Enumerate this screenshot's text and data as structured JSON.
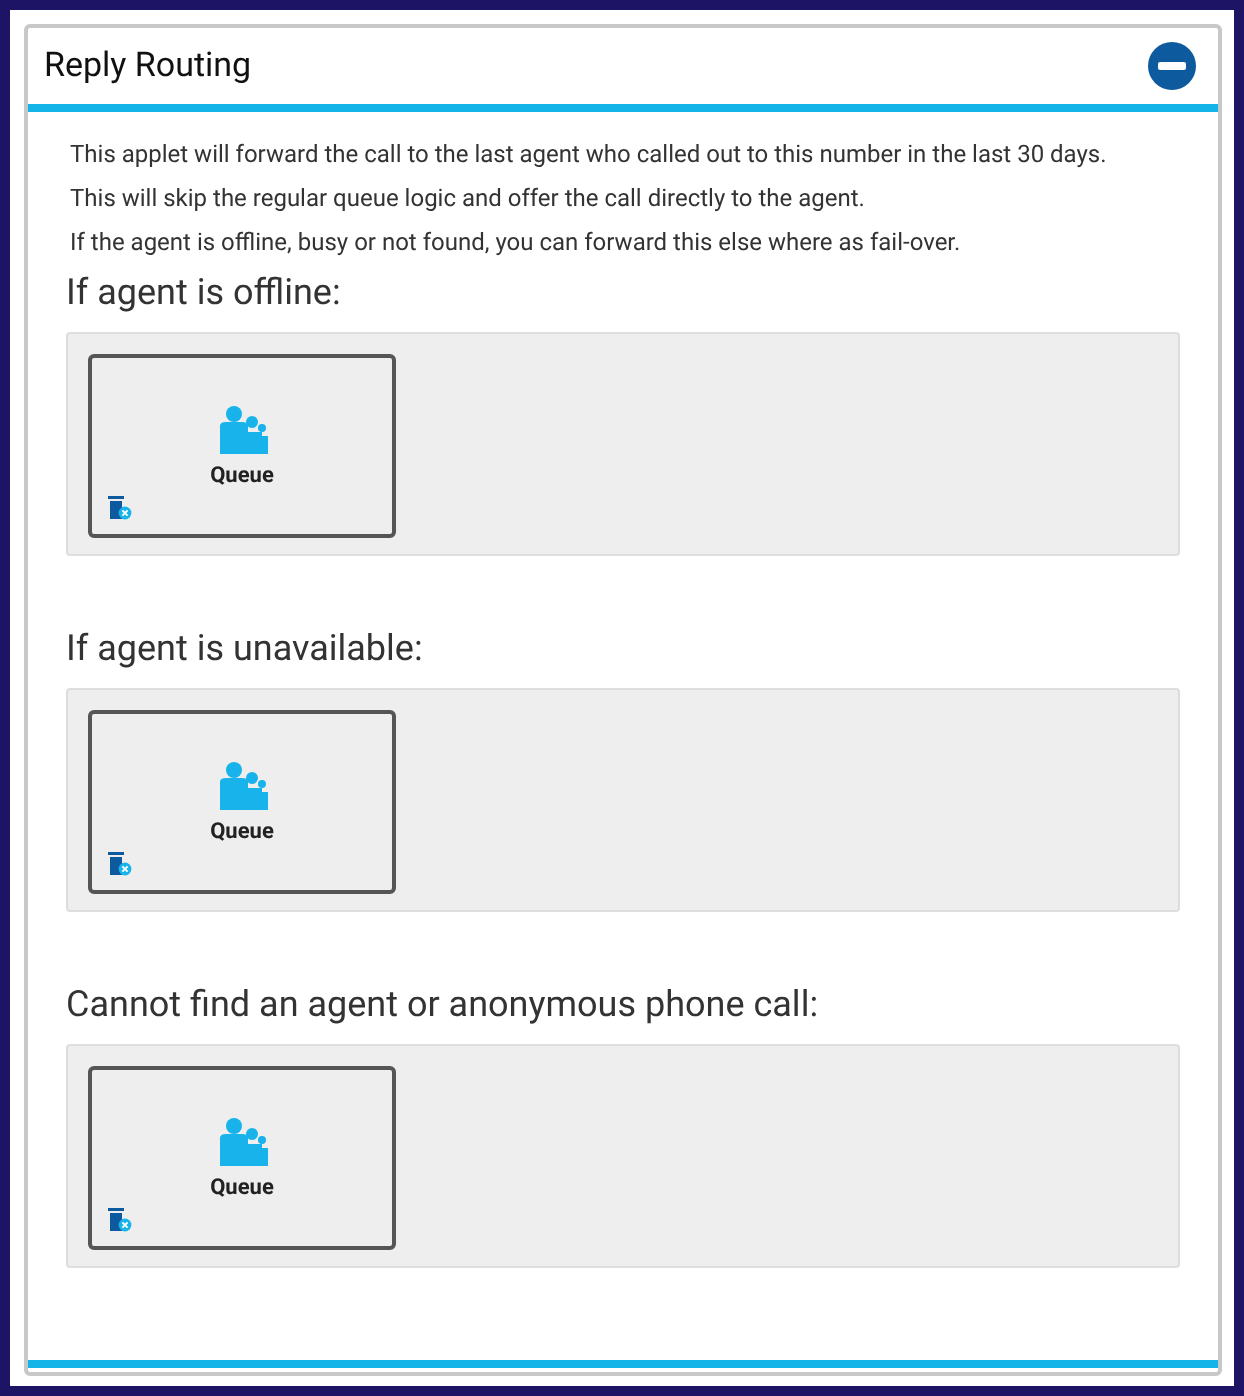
{
  "panel": {
    "title": "Reply Routing",
    "expanded": true
  },
  "description": [
    "This applet will forward the call to the last agent who called out to this number in the last 30 days.",
    "This will skip the regular queue logic and offer the call directly to the agent.",
    "If the agent is offline, busy or not found, you can forward this else where as fail-over."
  ],
  "sections": [
    {
      "heading": "If agent is offline:",
      "items": [
        {
          "kind": "queue",
          "label": "Queue"
        }
      ]
    },
    {
      "heading": "If agent is unavailable:",
      "items": [
        {
          "kind": "queue",
          "label": "Queue"
        }
      ]
    },
    {
      "heading": "Cannot find an agent or anonymous phone call:",
      "items": [
        {
          "kind": "queue",
          "label": "Queue"
        }
      ]
    }
  ]
}
